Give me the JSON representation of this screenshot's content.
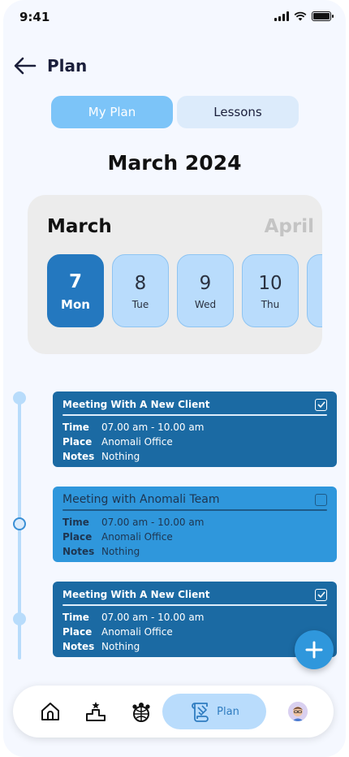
{
  "status_bar": {
    "time": "9:41"
  },
  "header": {
    "title": "Plan"
  },
  "tabs": [
    {
      "label": "My Plan",
      "active": true
    },
    {
      "label": "Lessons",
      "active": false
    }
  ],
  "month_title": "March 2024",
  "calendar": {
    "current_month": "March",
    "next_month": "April",
    "days": [
      {
        "num": "7",
        "dow": "Mon",
        "active": true
      },
      {
        "num": "8",
        "dow": "Tue",
        "active": false
      },
      {
        "num": "9",
        "dow": "Wed",
        "active": false
      },
      {
        "num": "10",
        "dow": "Thu",
        "active": false
      }
    ]
  },
  "events": [
    {
      "title": "Meeting With A New Client",
      "checked": true,
      "time_label": "Time",
      "time": "07.00 am - 10.00 am",
      "place_label": "Place",
      "place": "Anomali Office",
      "notes_label": "Notes",
      "notes": "Nothing"
    },
    {
      "title": "Meeting with Anomali Team",
      "checked": false,
      "time_label": "Time",
      "time": "07.00 am - 10.00 am",
      "place_label": "Place",
      "place": "Anomali Office",
      "notes_label": "Notes",
      "notes": "Nothing"
    },
    {
      "title": "Meeting With A New Client",
      "checked": true,
      "time_label": "Time",
      "time": "07.00 am - 10.00 am",
      "place_label": "Place",
      "place": "Anomali Office",
      "notes_label": "Notes",
      "notes": "Nothing"
    }
  ],
  "bottom_nav": {
    "items": [
      "home-icon",
      "leaderboard-icon",
      "community-icon",
      "plan-icon",
      "avatar"
    ],
    "active_label": "Plan"
  },
  "colors": {
    "accent": "#2f97dc",
    "active_day": "#2478bf",
    "event_dark": "#1b6aa3",
    "tab_active": "#7cc4f8"
  }
}
